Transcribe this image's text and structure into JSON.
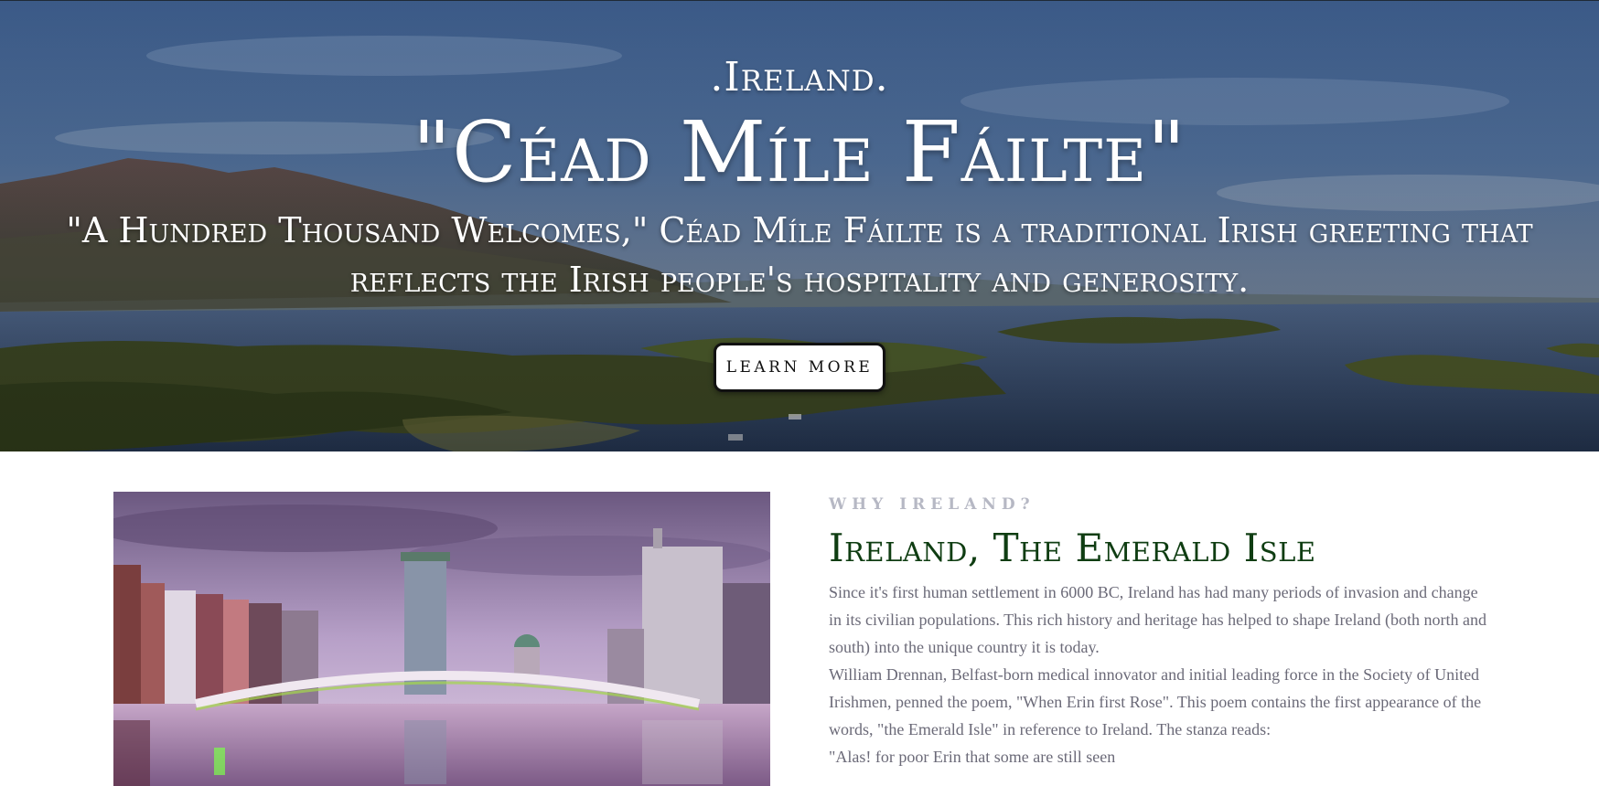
{
  "hero": {
    "brand": ".Ireland.",
    "title": "\"Céad Míle Fáilte\"",
    "subtitle": "\"A Hundred Thousand Welcomes,\" Céad Míle Fáilte is a traditional Irish greeting that reflects the Irish people's hospitality and generosity.",
    "cta_label": "Learn More"
  },
  "intro": {
    "eyebrow": "Why Ireland?",
    "title": "Ireland, The Emerald Isle",
    "paragraphs": [
      "Since it's first human settlement in 6000 BC, Ireland has had many periods of invasion and change in its civilian populations. This rich history and heritage has helped to shape Ireland (both north and south) into the unique country it is today.",
      "William Drennan, Belfast-born medical innovator and initial leading force in the Society of United Irishmen, penned the poem, \"When Erin first Rose\". This poem contains the first appearance of the words, \"the Emerald Isle\" in reference to Ireland. The stanza reads:",
      "\"Alas! for poor Erin that some are still seen"
    ]
  },
  "colors": {
    "title_green": "#0f3d12",
    "eyebrow_gray": "#b6b8c4",
    "body_gray": "#6b6a78",
    "button_bg": "#ffffff",
    "button_border": "#111111"
  }
}
